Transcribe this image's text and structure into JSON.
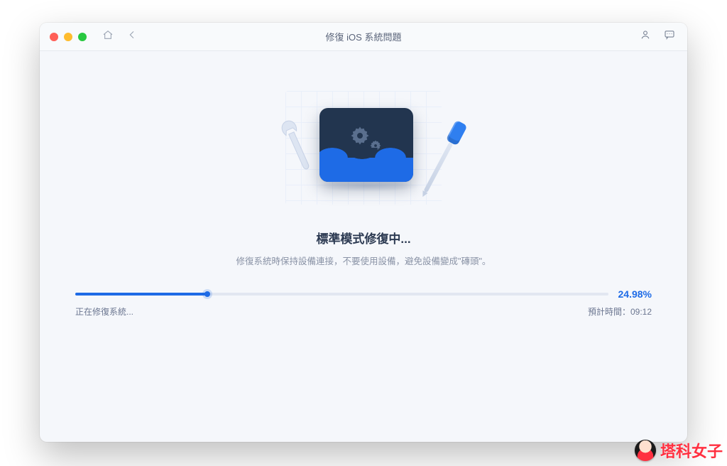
{
  "titlebar": {
    "title": "修復 iOS 系統問題"
  },
  "main": {
    "heading": "標準模式修復中...",
    "subtext": "修復系統時保持設備連接，不要使用設備，避免設備變成\"磚頭\"。"
  },
  "progress": {
    "percent_value": 24.98,
    "percent_label": "24.98%",
    "fill_width_css": "24.98%",
    "status_text": "正在修復系統...",
    "eta_label": "預計時間：",
    "eta_value": "09:12"
  },
  "watermark": {
    "text": "塔科女子"
  }
}
